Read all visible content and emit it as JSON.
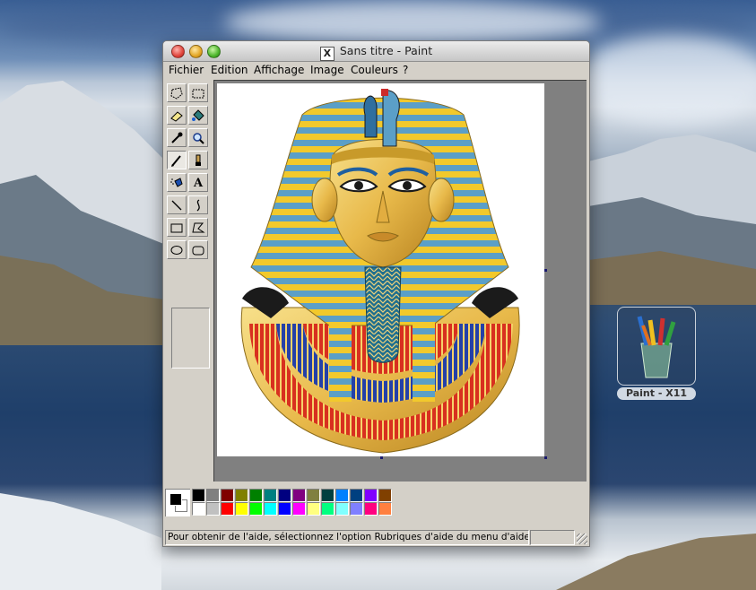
{
  "window": {
    "title": "Sans titre - Paint",
    "x11_badge": "X"
  },
  "menu": [
    {
      "label": "Fichier"
    },
    {
      "label": "Edition"
    },
    {
      "label": "Affichage"
    },
    {
      "label": "Image"
    },
    {
      "label": "Couleurs"
    },
    {
      "label": "?"
    }
  ],
  "tools": [
    {
      "name": "free-select-icon"
    },
    {
      "name": "rect-select-icon"
    },
    {
      "name": "eraser-icon"
    },
    {
      "name": "fill-bucket-icon"
    },
    {
      "name": "color-picker-icon"
    },
    {
      "name": "magnifier-icon"
    },
    {
      "name": "pencil-icon",
      "active": true
    },
    {
      "name": "brush-icon"
    },
    {
      "name": "airbrush-icon"
    },
    {
      "name": "text-icon",
      "glyph": "A"
    },
    {
      "name": "line-icon"
    },
    {
      "name": "curve-icon"
    },
    {
      "name": "rectangle-icon"
    },
    {
      "name": "polygon-icon"
    },
    {
      "name": "ellipse-icon"
    },
    {
      "name": "rounded-rect-icon"
    }
  ],
  "palette": {
    "top_row": [
      "#000000",
      "#808080",
      "#800000",
      "#808000",
      "#008000",
      "#008080",
      "#000080",
      "#800080",
      "#808040",
      "#004040",
      "#0080ff",
      "#004080",
      "#8000ff",
      "#804000"
    ],
    "bottom_row": [
      "#ffffff",
      "#c0c0c0",
      "#ff0000",
      "#ffff00",
      "#00ff00",
      "#00ffff",
      "#0000ff",
      "#ff00ff",
      "#ffff80",
      "#00ff80",
      "#80ffff",
      "#8080ff",
      "#ff0080",
      "#ff8040"
    ],
    "foreground": "#000000",
    "background": "#ffffff"
  },
  "status": {
    "help_text": "Pour obtenir de l'aide, sélectionnez l'option Rubriques d'aide du menu d'aide."
  },
  "desktop_icon": {
    "label": "Paint - X11"
  }
}
